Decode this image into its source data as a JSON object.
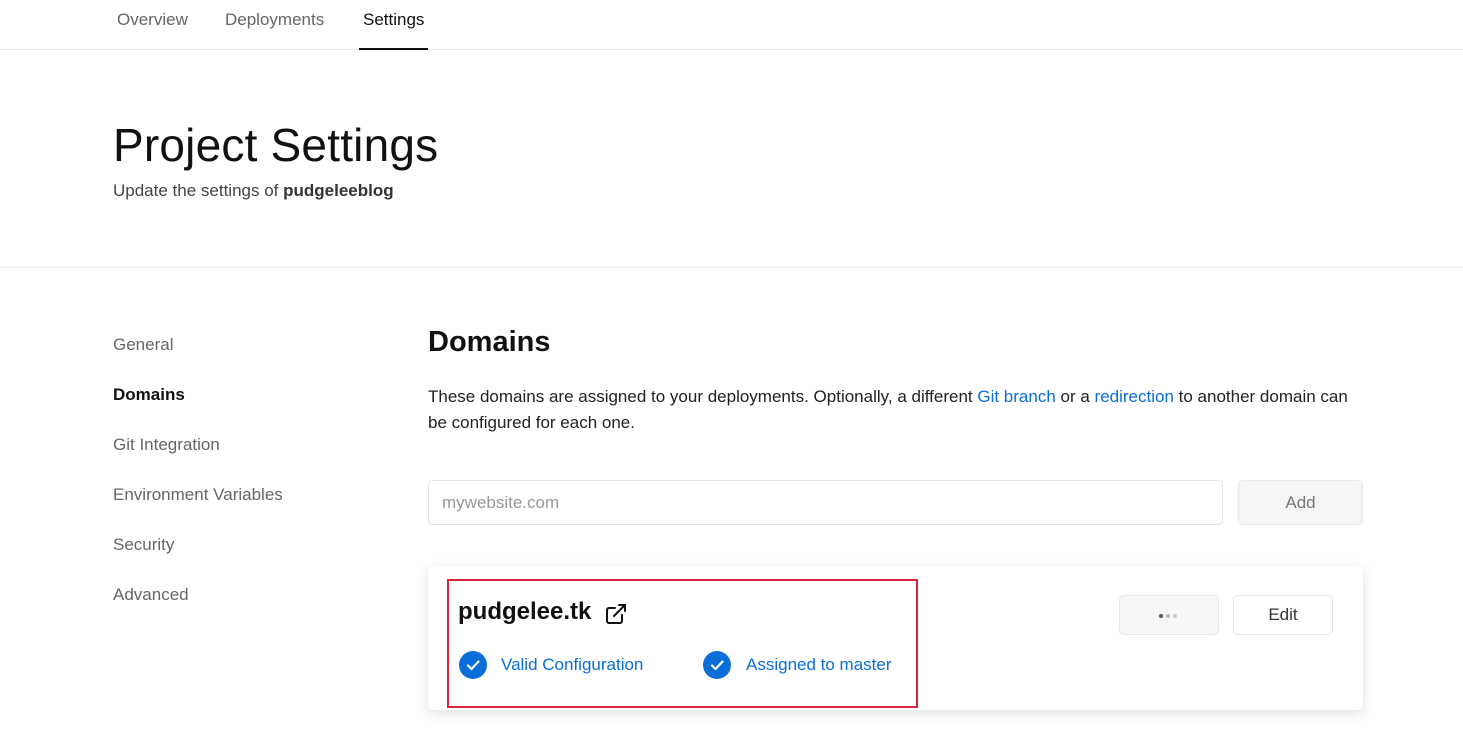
{
  "topnav": {
    "tabs": [
      {
        "label": "Overview"
      },
      {
        "label": "Deployments"
      },
      {
        "label": "Settings",
        "active": true
      }
    ]
  },
  "header": {
    "title": "Project Settings",
    "subtitle_prefix": "Update the settings of ",
    "project_name": "pudgeleeblog"
  },
  "sidebar": {
    "items": [
      {
        "label": "General"
      },
      {
        "label": "Domains",
        "active": true
      },
      {
        "label": "Git Integration"
      },
      {
        "label": "Environment Variables"
      },
      {
        "label": "Security"
      },
      {
        "label": "Advanced"
      }
    ]
  },
  "domains": {
    "title": "Domains",
    "description": {
      "part1": "These domains are assigned to your deployments. Optionally, a different ",
      "link1": "Git branch",
      "part2": " or a ",
      "link2": "redirection",
      "part3": " to another domain can be configured for each one."
    },
    "input": {
      "placeholder": "mywebsite.com",
      "value": ""
    },
    "add_label": "Add",
    "list": [
      {
        "name": "pudgelee.tk",
        "status": [
          {
            "label": "Valid Configuration",
            "icon": "check-circle-icon"
          },
          {
            "label": "Assigned to master",
            "icon": "check-circle-icon"
          }
        ],
        "edit_label": "Edit"
      }
    ]
  },
  "colors": {
    "accent": "#0a6ed8",
    "highlight": "#d9263c",
    "text": "#111111",
    "muted": "#666666"
  }
}
